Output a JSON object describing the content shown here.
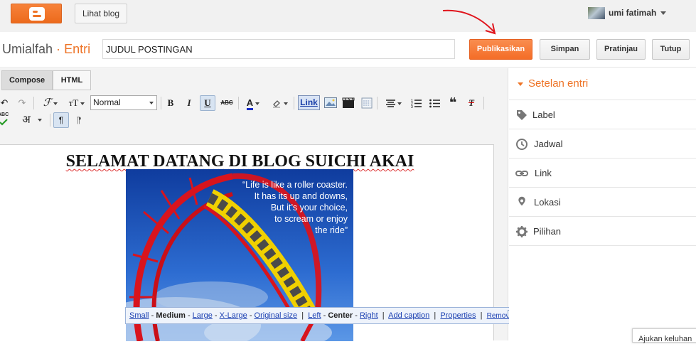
{
  "topbar": {
    "logo_icon": "blogger-logo-icon",
    "view_blog": "Lihat blog",
    "account_name": "umi fatimah"
  },
  "title_row": {
    "blog_name": "Umialfah",
    "separator": "·",
    "section": "Entri",
    "post_title": "JUDUL POSTINGAN",
    "buttons": {
      "publish": "Publikasikan",
      "save": "Simpan",
      "preview": "Pratinjau",
      "close": "Tutup"
    }
  },
  "editor": {
    "tabs": {
      "compose": "Compose",
      "html": "HTML"
    },
    "toolbar": {
      "undo_icon": "↶",
      "redo_icon": "↷",
      "font_icon": "ℱ",
      "font_size_icon": "тT",
      "format_value": "Normal",
      "bold": "B",
      "italic": "I",
      "underline": "U",
      "strike": "ABC",
      "text_color_icon": "A",
      "link": "Link",
      "quote_icon": "❝",
      "clear_format_icon": "T",
      "spell_icon": "ABC",
      "hindi_input": "अ",
      "ltr_icon": "¶",
      "rtl_icon": "¶"
    },
    "content": {
      "heading": "SELAMAT DATANG DI BLOG SUICHI AKAI",
      "image_quote": {
        "line1": "“Life is like a roller coaster.",
        "line2": "It has its up and downs,",
        "line3": "But it’s your choice,",
        "line4": "to scream or enjoy",
        "line5": "the ride”"
      }
    },
    "image_bubble": {
      "small": "Small",
      "medium": "Medium",
      "large": "Large",
      "xlarge": "X-Large",
      "original": "Original size",
      "left": "Left",
      "center": "Center",
      "right": "Right",
      "caption": "Add caption",
      "properties": "Properties",
      "remove": "Remove",
      "dash": "-",
      "pipe": "|",
      "close": "✕"
    }
  },
  "sidebar": {
    "header": "Setelan entri",
    "items": [
      {
        "label": "Label",
        "icon": "tag-icon"
      },
      {
        "label": "Jadwal",
        "icon": "clock-icon"
      },
      {
        "label": "Link",
        "icon": "link-icon"
      },
      {
        "label": "Lokasi",
        "icon": "location-pin-icon"
      },
      {
        "label": "Pilihan",
        "icon": "gear-icon"
      }
    ]
  },
  "feedback": {
    "label": "Ajukan keluhan"
  },
  "colors": {
    "accent": "#ee7427",
    "publish_button": "#f46d27",
    "link_blue": "#1a3fb1",
    "annotation_arrow": "#e0141c"
  }
}
